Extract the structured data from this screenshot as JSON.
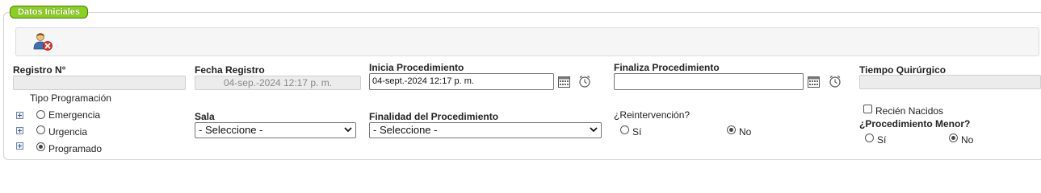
{
  "section": {
    "title": "Datos Iniciales"
  },
  "toolbar": {
    "icon": "user-cancel-icon"
  },
  "registro": {
    "label": "Registro N°",
    "value": ""
  },
  "fecha_registro": {
    "label": "Fecha Registro",
    "value": "04-sep.-2024 12:17 p. m."
  },
  "inicia": {
    "label": "Inicia Procedimiento",
    "value": "04-sept.-2024 12:17 p. m.",
    "calendar_icon": "calendar-icon",
    "clock_icon": "clock-icon"
  },
  "finaliza": {
    "label": "Finaliza Procedimiento",
    "value": "",
    "calendar_icon": "calendar-icon",
    "clock_icon": "clock-icon"
  },
  "tiempo": {
    "label": "Tiempo Quirúrgico",
    "value": ""
  },
  "tipo_programacion": {
    "label": "Tipo Programación",
    "options": [
      {
        "label": "Emergencia",
        "selected": false
      },
      {
        "label": "Urgencia",
        "selected": false
      },
      {
        "label": "Programado",
        "selected": true
      }
    ]
  },
  "sala": {
    "label": "Sala",
    "selected": "- Seleccione -"
  },
  "finalidad": {
    "label": "Finalidad del Procedimiento",
    "selected": "- Seleccione -"
  },
  "reintervencion": {
    "label": "¿Reintervención?",
    "yes": "Sí",
    "no": "No",
    "selected": "No"
  },
  "recien_nacidos": {
    "label": "Recién Nacidos",
    "checked": false
  },
  "procedimiento_menor": {
    "label": "¿Procedimiento Menor?",
    "yes": "Sí",
    "no": "No",
    "selected": "No"
  }
}
